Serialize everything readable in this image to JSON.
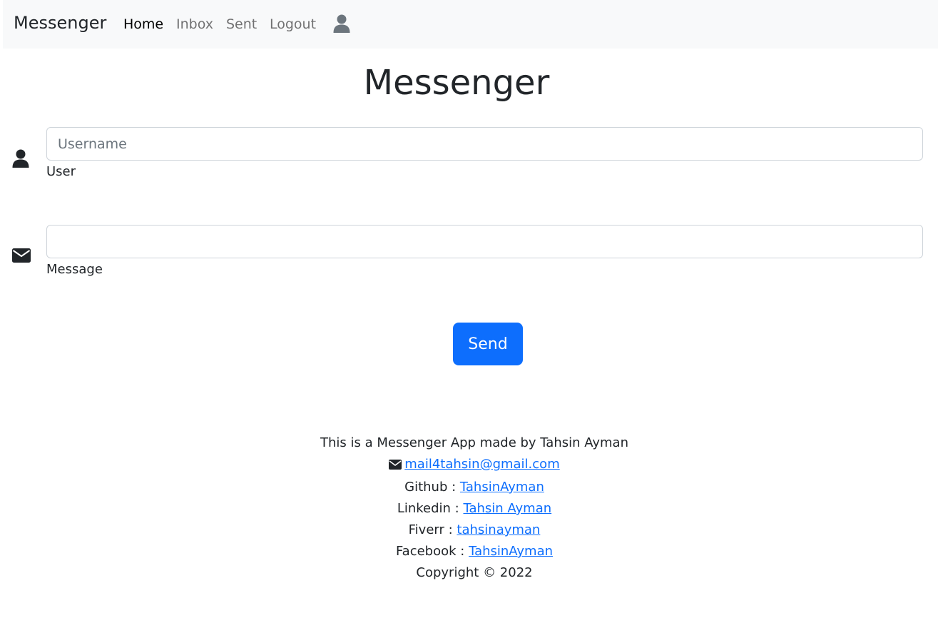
{
  "navbar": {
    "brand": "Messenger",
    "links": [
      "Home",
      "Inbox",
      "Sent",
      "Logout"
    ],
    "user_icon": "user-icon"
  },
  "main": {
    "title": "Messenger",
    "user_field": {
      "icon": "user-icon",
      "placeholder": "Username",
      "value": "",
      "label": "User"
    },
    "message_field": {
      "icon": "envelope-icon",
      "placeholder": "",
      "value": "",
      "label": "Message"
    },
    "send_label": "Send"
  },
  "footer": {
    "intro": "This is a Messenger App made by Tahsin Ayman",
    "email": "mail4tahsin@gmail.com",
    "github_label": "Github : ",
    "github_link": "TahsinAyman",
    "linkedin_label": "Linkedin : ",
    "linkedin_link": "Tahsin Ayman",
    "fiverr_label": "Fiverr : ",
    "fiverr_link": "tahsinayman",
    "facebook_label": "Facebook : ",
    "facebook_link": "TahsinAyman",
    "copyright": "Copyright © 2022"
  },
  "colors": {
    "primary": "#0d6efd",
    "navbar_bg": "#f8f9fa",
    "text": "#212529",
    "muted_nav": "#6c757d"
  }
}
